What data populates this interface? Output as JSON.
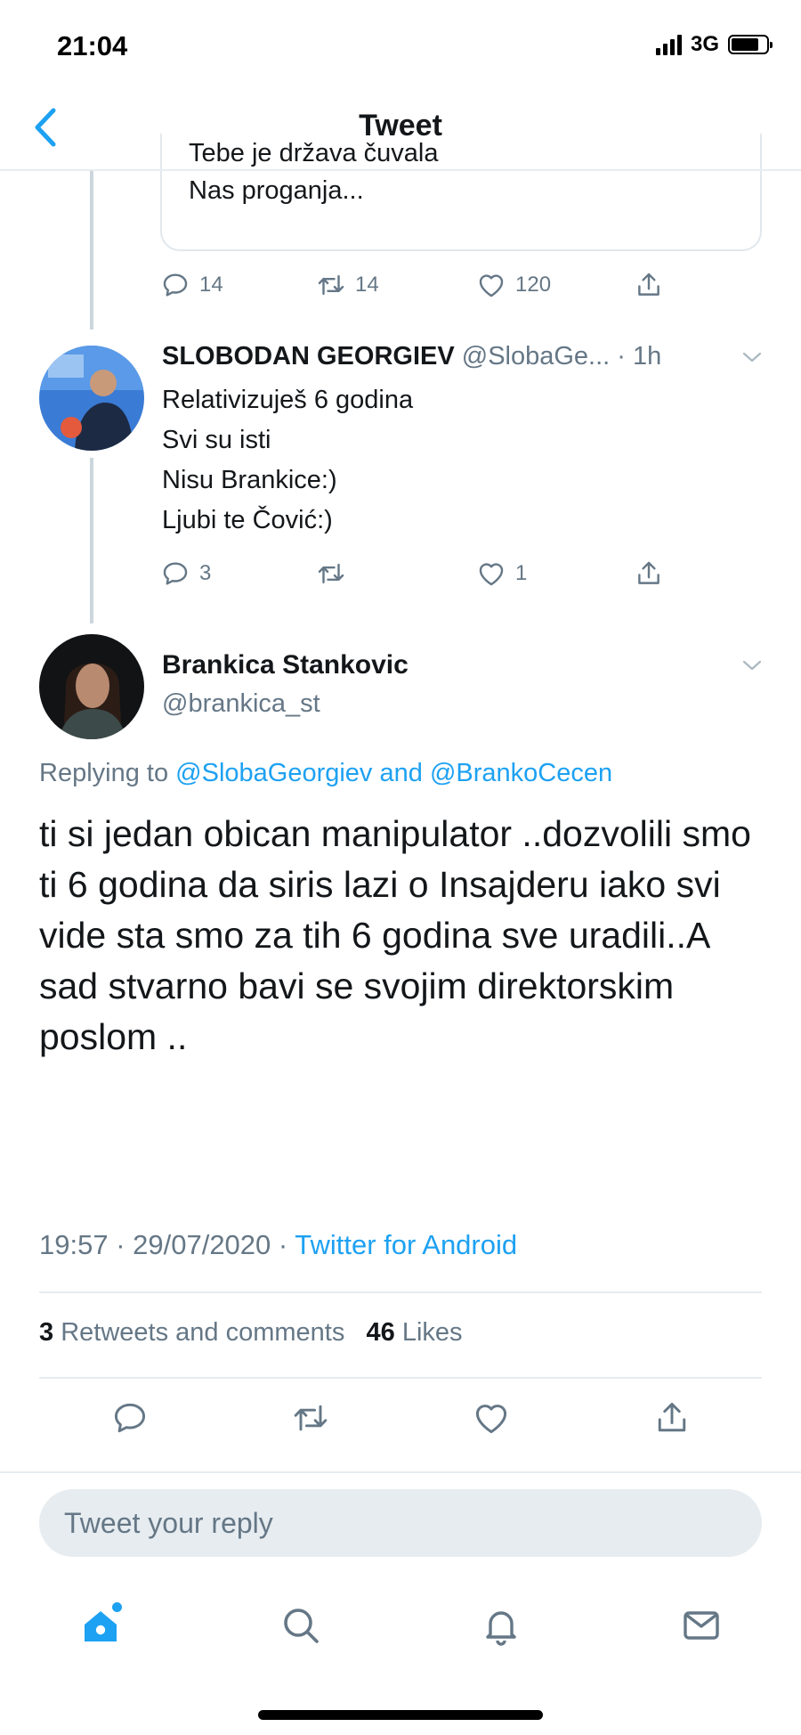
{
  "status": {
    "time": "21:04",
    "network": "3G"
  },
  "nav": {
    "title": "Tweet"
  },
  "quoted": {
    "line1": "Tebe je država čuvala",
    "line2": "Nas proganja..."
  },
  "tweet1_actions": {
    "replies": "14",
    "retweets": "14",
    "likes": "120"
  },
  "reply_tweet": {
    "name": "SLOBODAN GEORGIEV",
    "handle": "@SlobaGe...",
    "time": "· 1h",
    "lines": [
      "Relativizuješ 6 godina",
      "Svi su isti",
      "Nisu Brankice:)",
      "Ljubi te Čović:)"
    ],
    "replies": "3",
    "retweets": "",
    "likes": "1"
  },
  "main_tweet": {
    "name": "Brankica Stankovic",
    "handle": "@brankica_st",
    "replying_prefix": "Replying to",
    "mention1": "@SlobaGeorgiev",
    "and_word": "and",
    "mention2": "@BrankoCecen",
    "body": "ti si jedan obican manipulator ..dozvolili smo ti 6 godina da siris lazi o Insajderu iako svi vide sta smo za tih 6 godina sve uradili..A sad stvarno bavi se svojim direktorskim poslom ..",
    "timestamp": "19:57 · 29/07/2020 ·",
    "source": "Twitter for Android",
    "retweet_count": "3",
    "retweet_label": "Retweets and comments",
    "like_count": "46",
    "like_label": "Likes"
  },
  "compose": {
    "placeholder": "Tweet your reply"
  },
  "colors": {
    "accent": "#1da1f2",
    "secondary_text": "#657786",
    "divider": "#e6ecf0"
  },
  "icons": [
    "back-chevron-icon",
    "reply-icon",
    "retweet-icon",
    "like-icon",
    "share-icon",
    "home-icon",
    "search-icon",
    "notifications-icon",
    "messages-icon"
  ]
}
